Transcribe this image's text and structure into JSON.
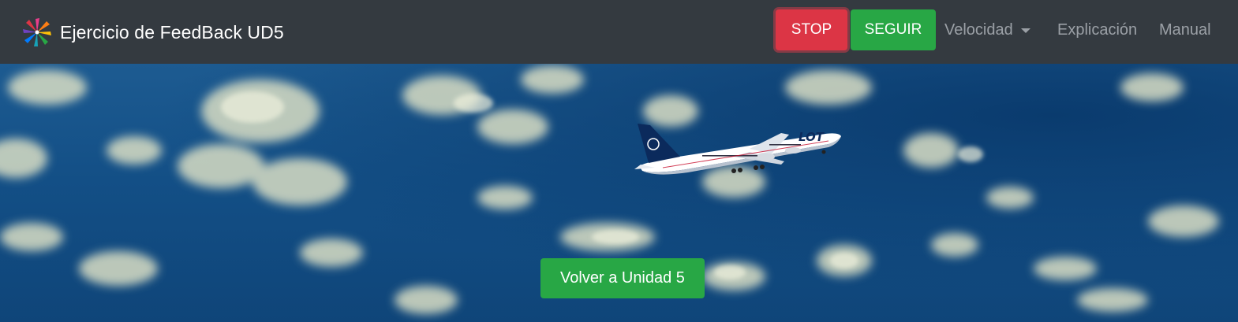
{
  "navbar": {
    "brand_title": "Ejercicio de FeedBack UD5",
    "logo_icon": "star-burst-logo-icon",
    "stop_label": "STOP",
    "seguir_label": "SEGUIR",
    "velocidad_label": "Velocidad",
    "explicacion_label": "Explicación",
    "manual_label": "Manual"
  },
  "hero": {
    "background": "sky-with-clouds",
    "airplane_livery_text": "LOT",
    "volver_label": "Volver a Unidad 5"
  },
  "colors": {
    "navbar_bg": "#343a40",
    "stop_bg": "#dc3545",
    "success_bg": "#28a745",
    "nav_link": "#9ba0a6",
    "sky": "#134f86"
  }
}
